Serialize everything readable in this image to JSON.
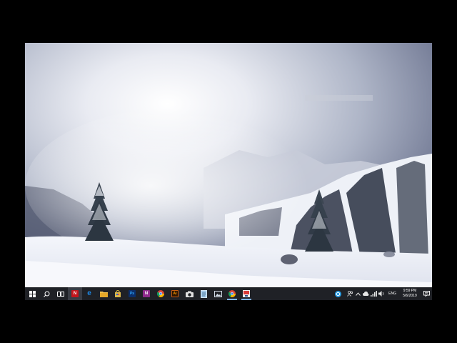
{
  "desktop": {
    "wallpaper": "snowy-mountain-landscape"
  },
  "taskbar": {
    "start_icon": "windows-logo-icon",
    "search_icon": "search-icon",
    "taskview_icon": "task-view-icon",
    "pinned": [
      {
        "name": "netflix",
        "glyph": "N",
        "color": "#c4151c"
      },
      {
        "name": "edge",
        "glyph": "e",
        "color": "#1e88e5"
      },
      {
        "name": "file-explorer",
        "glyph": "",
        "color": "#f2c14e"
      },
      {
        "name": "store",
        "glyph": "",
        "color": "#dcb84a"
      },
      {
        "name": "photoshop",
        "glyph": "Ps",
        "color": "#0b2f6b"
      },
      {
        "name": "onenote",
        "glyph": "N",
        "color": "#8e2a8c"
      },
      {
        "name": "chrome",
        "glyph": "",
        "color": "#34a853"
      },
      {
        "name": "illustrator",
        "glyph": "Ai",
        "color": "#c75b12"
      },
      {
        "name": "camera",
        "glyph": "",
        "color": "#e0e0e0"
      },
      {
        "name": "notepad",
        "glyph": "",
        "color": "#9fc7e8"
      },
      {
        "name": "photos",
        "glyph": "",
        "color": "#cfd8e3"
      },
      {
        "name": "chrome-running",
        "glyph": "",
        "color": "#e0453a"
      },
      {
        "name": "screen-recorder",
        "glyph": "",
        "color": "#d83a3a"
      }
    ]
  },
  "tray": {
    "language": "ENG",
    "time": "9:59 PM",
    "date": "5/6/2019",
    "icons": [
      "cortana-icon",
      "people-icon",
      "chevron-up-icon",
      "cloud-icon",
      "network-icon",
      "volume-icon"
    ]
  }
}
